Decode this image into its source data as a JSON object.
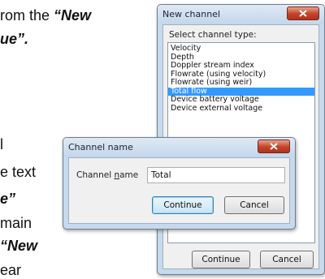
{
  "document": {
    "fragments": [
      {
        "id": "line1",
        "plain": "rom the ",
        "bold": "“New"
      },
      {
        "id": "line2",
        "plain": "",
        "bold": "ue”."
      },
      {
        "id": "line3",
        "plain": "l",
        "bold": ""
      },
      {
        "id": "line4",
        "plain": "e text",
        "bold": ""
      },
      {
        "id": "line5",
        "plain": "",
        "bold": "e”"
      },
      {
        "id": "line6",
        "plain": "main",
        "bold": ""
      },
      {
        "id": "line7",
        "plain": "",
        "bold": "“New"
      },
      {
        "id": "line8",
        "plain": "ear",
        "bold": ""
      }
    ]
  },
  "new_channel_dialog": {
    "title": "New channel",
    "prompt": "Select channel type:",
    "options": [
      "Velocity",
      "Depth",
      "Doppler stream index",
      "Flowrate (using velocity)",
      "Flowrate (using weir)",
      "Total flow",
      "Device battery voltage",
      "Device external voltage"
    ],
    "selected": "Total flow",
    "continue_label": "Continue",
    "cancel_label": "Cancel"
  },
  "channel_name_dialog": {
    "title": "Channel name",
    "field_label_pre": "Channel ",
    "field_label_accel": "n",
    "field_label_post": "ame",
    "field_value": "Total",
    "continue_label": "Continue",
    "cancel_label": "Cancel"
  },
  "colors": {
    "selection": "#3399ff",
    "close_button": "#c2422a",
    "window_frame": "#c7d9ec"
  }
}
